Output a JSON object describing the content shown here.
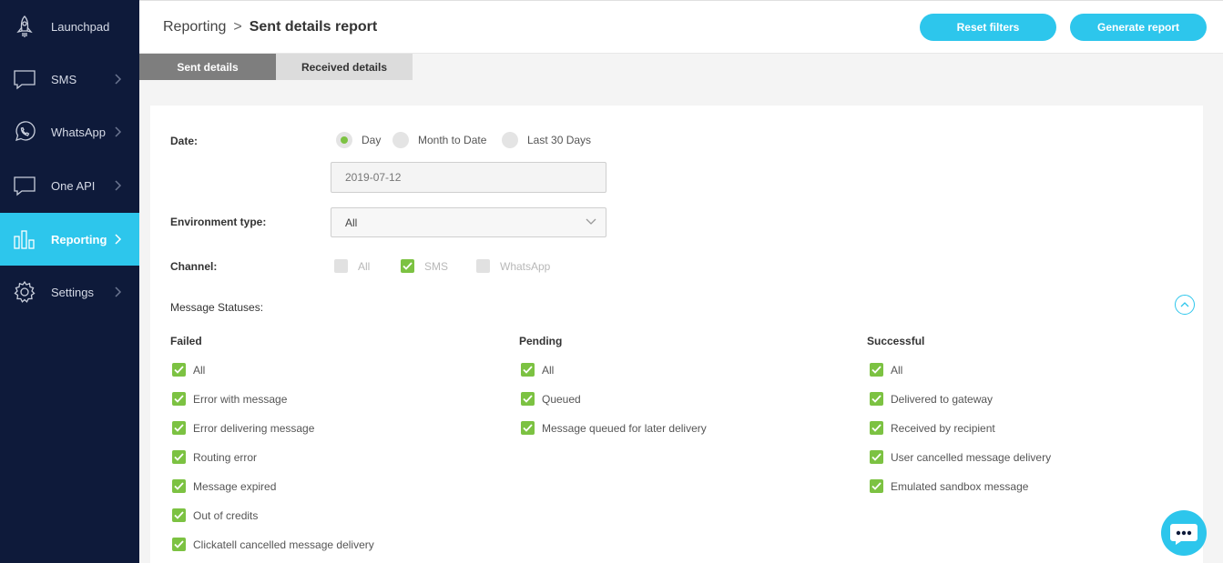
{
  "sidebar": {
    "items": [
      {
        "label": "Launchpad",
        "icon": "rocket-icon"
      },
      {
        "label": "SMS",
        "icon": "chat-bubble-icon"
      },
      {
        "label": "WhatsApp",
        "icon": "whatsapp-icon"
      },
      {
        "label": "One API",
        "icon": "chat-bubble-icon"
      },
      {
        "label": "Reporting",
        "icon": "bar-chart-icon",
        "active": true
      },
      {
        "label": "Settings",
        "icon": "gear-icon"
      }
    ]
  },
  "header": {
    "breadcrumb_parent": "Reporting",
    "breadcrumb_sep": ">",
    "breadcrumb_current": "Sent details report",
    "reset_label": "Reset filters",
    "generate_label": "Generate report"
  },
  "tabs": [
    {
      "label": "Sent details",
      "active": true
    },
    {
      "label": "Received details",
      "active": false
    }
  ],
  "form": {
    "date_label": "Date:",
    "date_options": [
      {
        "label": "Day",
        "selected": true
      },
      {
        "label": "Month to Date",
        "selected": false
      },
      {
        "label": "Last 30 Days",
        "selected": false
      }
    ],
    "date_value": "2019-07-12",
    "env_label": "Environment type:",
    "env_value": "All",
    "channel_label": "Channel:",
    "channels": [
      {
        "label": "All",
        "checked": false
      },
      {
        "label": "SMS",
        "checked": true
      },
      {
        "label": "WhatsApp",
        "checked": false
      }
    ],
    "statuses_label": "Message Statuses:"
  },
  "statuses": {
    "failed": {
      "title": "Failed",
      "items": [
        "All",
        "Error with message",
        "Error delivering message",
        "Routing error",
        "Message expired",
        "Out of credits",
        "Clickatell cancelled message delivery"
      ]
    },
    "pending": {
      "title": "Pending",
      "items": [
        "All",
        "Queued",
        "Message queued for later delivery"
      ]
    },
    "successful": {
      "title": "Successful",
      "items": [
        "All",
        "Delivered to gateway",
        "Received by recipient",
        "User cancelled message delivery",
        "Emulated sandbox message"
      ]
    }
  },
  "colors": {
    "sidebar_bg": "#0e1a3a",
    "accent": "#2dc6ec",
    "check_green": "#7cc242"
  }
}
